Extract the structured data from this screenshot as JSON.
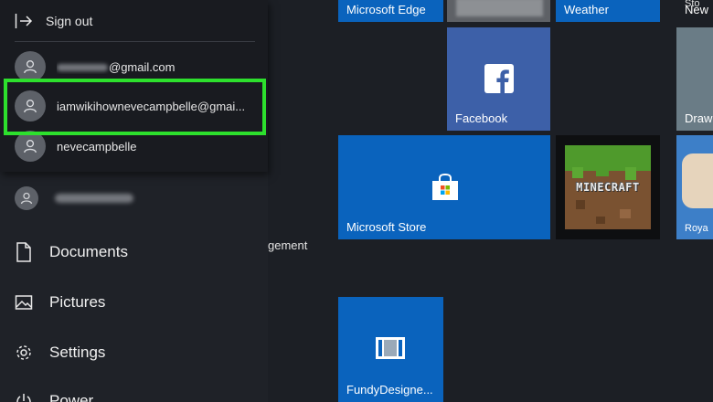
{
  "start_menu": {
    "sign_out_label": "Sign out",
    "accounts": [
      {
        "label": "@gmail.com",
        "redacted_prefix": true
      },
      {
        "label": "iamwikihownevecampbelle@gmai...",
        "highlighted": true
      },
      {
        "label": "nevecampbelle"
      }
    ],
    "current_user_redacted": true,
    "items": [
      {
        "label": "Documents",
        "icon": "document-icon"
      },
      {
        "label": "Pictures",
        "icon": "pictures-icon"
      },
      {
        "label": "Settings",
        "icon": "gear-icon"
      },
      {
        "label": "Power",
        "icon": "power-icon"
      }
    ],
    "partial_text": "gement"
  },
  "tiles": [
    {
      "label": "Microsoft Edge",
      "color": "#0a63bd"
    },
    {
      "label": "Weather",
      "color": "#0a63bd"
    },
    {
      "label": "New",
      "color": "#1c1f25"
    },
    {
      "label": "Facebook",
      "color": "#3b5998",
      "icon": "facebook-icon"
    },
    {
      "label": "Draw",
      "color": "#6c7f88"
    },
    {
      "label": "Microsoft Store",
      "color": "#0a63bd",
      "icon": "store-bag-icon"
    },
    {
      "label": "Minecraft",
      "logo_text": "MINECRAFT",
      "icon": "minecraft-grass-block"
    },
    {
      "label": "Roya",
      "color": "#3d7fc8"
    },
    {
      "label": "Sto",
      "color": "#1c1f25"
    },
    {
      "label": "FundyDesigne...",
      "color": "#0a63bd",
      "icon": "fundy-icon"
    }
  ],
  "colors": {
    "highlight": "#2de02d",
    "tile_blue": "#0a63bd",
    "facebook": "#3b5998"
  }
}
